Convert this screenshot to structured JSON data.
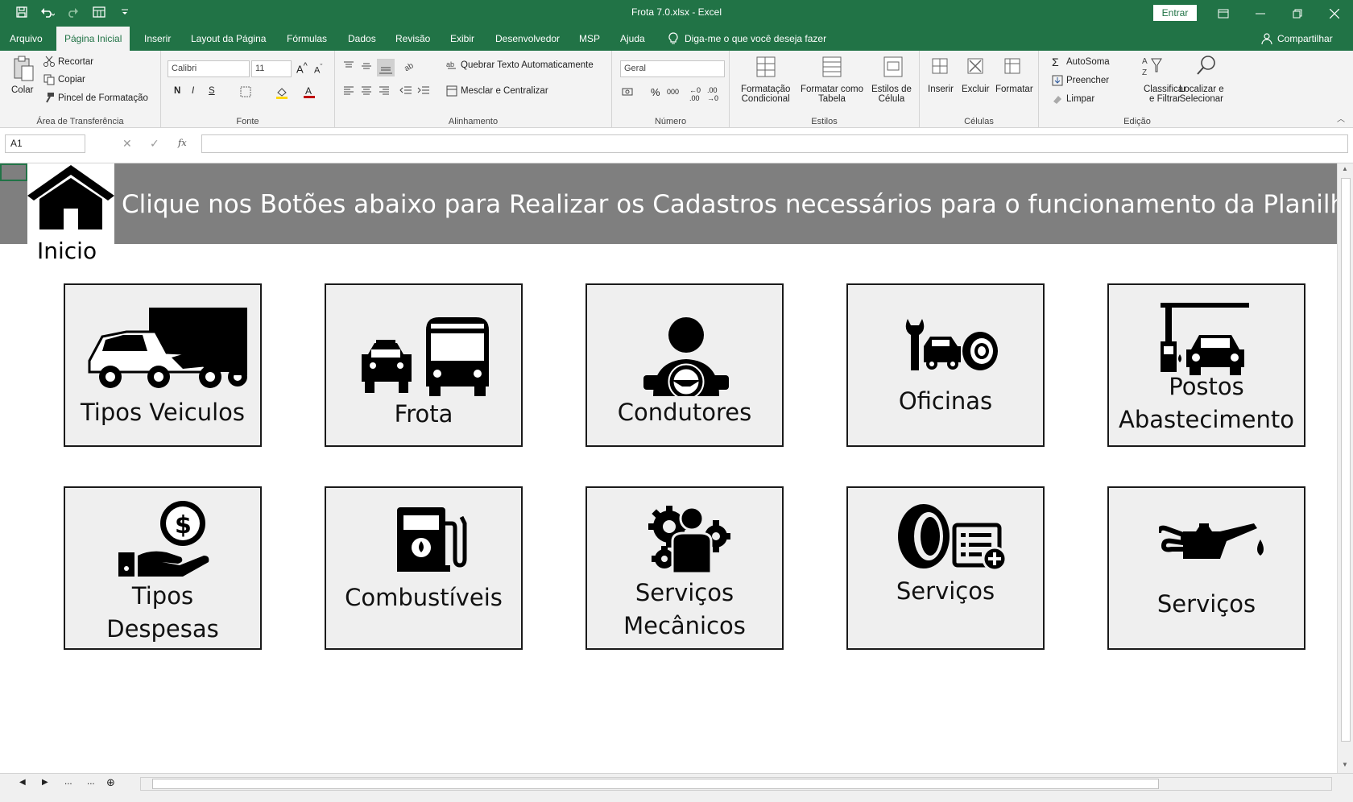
{
  "window": {
    "title": "Frota 7.0.xlsx  -  Excel",
    "signin": "Entrar"
  },
  "tabs": [
    {
      "label": "Arquivo"
    },
    {
      "label": "Página Inicial"
    },
    {
      "label": "Inserir"
    },
    {
      "label": "Layout da Página"
    },
    {
      "label": "Fórmulas"
    },
    {
      "label": "Dados"
    },
    {
      "label": "Revisão"
    },
    {
      "label": "Exibir"
    },
    {
      "label": "Desenvolvedor"
    },
    {
      "label": "MSP"
    },
    {
      "label": "Ajuda"
    }
  ],
  "tellme": "Diga-me o que você deseja fazer",
  "share": "Compartilhar",
  "ribbon": {
    "clipboard": {
      "paste": "Colar",
      "cut": "Recortar",
      "copy": "Copiar",
      "painter": "Pincel de Formatação",
      "label": "Área de Transferência"
    },
    "font": {
      "name": "Calibri",
      "size": "11",
      "bold": "N",
      "italic": "I",
      "underline": "S",
      "label": "Fonte"
    },
    "alignment": {
      "wrap": "Quebrar Texto Automaticamente",
      "merge": "Mesclar e Centralizar",
      "label": "Alinhamento"
    },
    "number": {
      "format": "Geral",
      "label": "Número"
    },
    "styles": {
      "conditional_1": "Formatação",
      "conditional_2": "Condicional",
      "table_1": "Formatar como",
      "table_2": "Tabela",
      "cell_1": "Estilos de",
      "cell_2": "Célula",
      "label": "Estilos"
    },
    "cells": {
      "insert": "Inserir",
      "delete": "Excluir",
      "format": "Formatar",
      "label": "Células"
    },
    "editing": {
      "autosum": "AutoSoma",
      "fill": "Preencher",
      "clear": "Limpar",
      "sort_1": "Classificar",
      "sort_2": "e Filtrar",
      "find_1": "Localizar e",
      "find_2": "Selecionar",
      "label": "Edição"
    }
  },
  "formula_bar": {
    "name_box": "A1",
    "fx": "fx",
    "value": ""
  },
  "sheet": {
    "banner_text": "Clique nos Botões abaixo para Realizar os Cadastros necessários para o funcionamento da Planilha.",
    "home_label": "Inicio",
    "cards": [
      {
        "line1": "Tipos Veiculos",
        "line2": "",
        "icon": "vehicles-icon"
      },
      {
        "line1": "Frota",
        "line2": "",
        "icon": "taxi-bus-icon"
      },
      {
        "line1": "Condutores",
        "line2": "",
        "icon": "driver-icon"
      },
      {
        "line1": "Oficinas",
        "line2": "",
        "icon": "workshop-icon"
      },
      {
        "line1": "Postos",
        "line2": "Abastecimento",
        "icon": "gas-station-icon"
      },
      {
        "line1": "Tipos",
        "line2": "Despesas",
        "icon": "expense-hand-icon"
      },
      {
        "line1": "Combustíveis",
        "line2": "",
        "icon": "fuel-pump-icon"
      },
      {
        "line1": "Serviços",
        "line2": "Mecânicos",
        "icon": "gears-person-icon"
      },
      {
        "line1": "Serviços",
        "line2": "",
        "icon": "tire-list-icon"
      },
      {
        "line1": "Serviços",
        "line2": "",
        "icon": "oil-can-icon"
      }
    ]
  },
  "bottom": {
    "ellipsis_1": "...",
    "ellipsis_2": "..."
  }
}
